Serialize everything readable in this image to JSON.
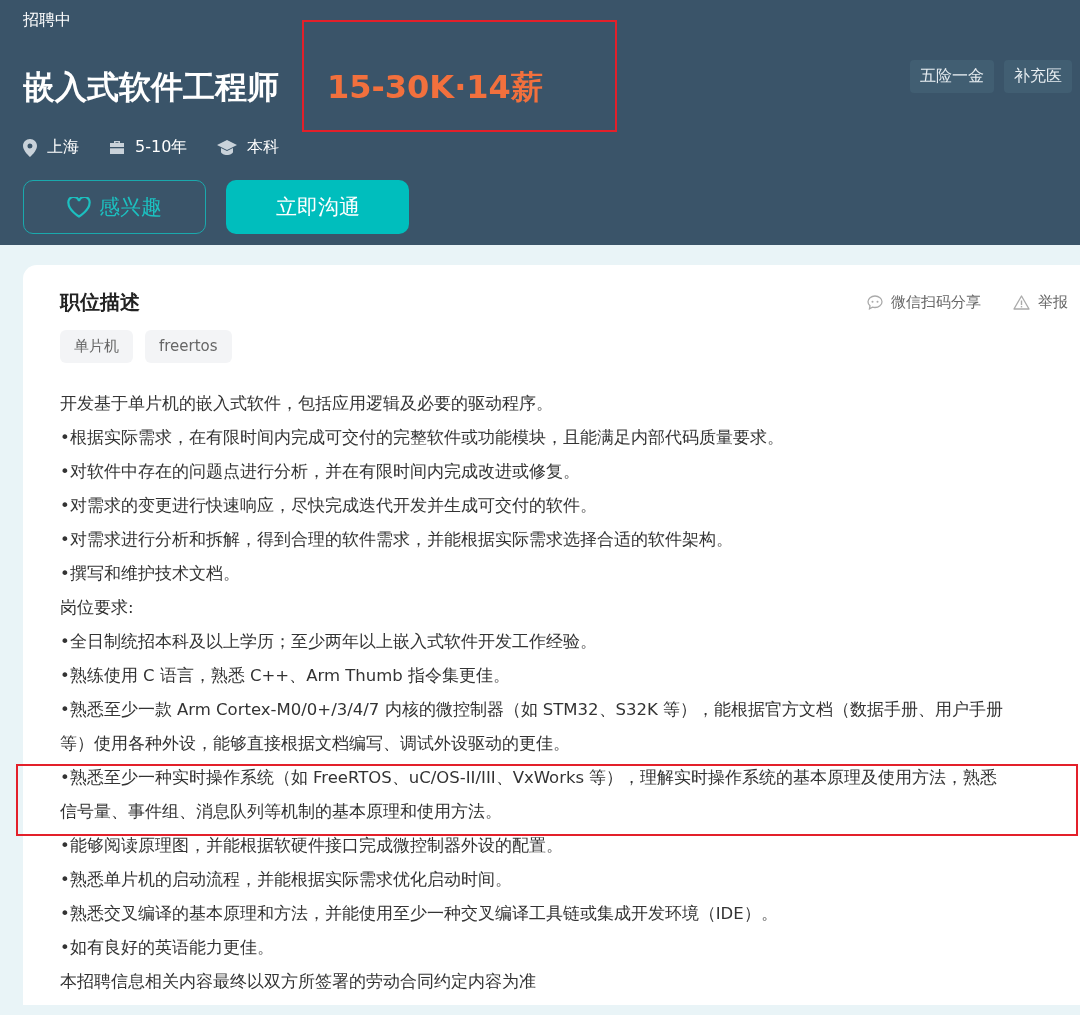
{
  "header": {
    "status": "招聘中",
    "title": "嵌入式软件工程师",
    "salary": {
      "text": "15-30K·14薪",
      "highlighted": true
    },
    "meta": [
      {
        "kind": "location",
        "text": "上海"
      },
      {
        "kind": "experience",
        "text": "5-10年"
      },
      {
        "kind": "education",
        "text": "本科"
      }
    ],
    "benefits": [
      "五险一金",
      "补充医"
    ],
    "buttons": [
      {
        "kind": "interest",
        "label": "感兴趣"
      },
      {
        "kind": "chat",
        "label": "立即沟通"
      }
    ]
  },
  "description": {
    "title": "职位描述",
    "actions": [
      {
        "kind": "share",
        "label": "微信扫码分享"
      },
      {
        "kind": "report",
        "label": "举报"
      }
    ],
    "tags": [
      "单片机",
      "freertos"
    ],
    "lines": [
      {
        "text": "开发基于单片机的嵌入式软件，包括应用逻辑及必要的驱动程序。",
        "highlighted": false
      },
      {
        "text": "•根据实际需求，在有限时间内完成可交付的完整软件或功能模块，且能满足内部代码质量要求。",
        "highlighted": false
      },
      {
        "text": "•对软件中存在的问题点进行分析，并在有限时间内完成改进或修复。",
        "highlighted": false
      },
      {
        "text": "•对需求的变更进行快速响应，尽快完成迭代开发并生成可交付的软件。",
        "highlighted": false
      },
      {
        "text": "•对需求进行分析和拆解，得到合理的软件需求，并能根据实际需求选择合适的软件架构。",
        "highlighted": false
      },
      {
        "text": "•撰写和维护技术文档。",
        "highlighted": false
      },
      {
        "text": "岗位要求:",
        "highlighted": false
      },
      {
        "text": "•全日制统招本科及以上学历；至少两年以上嵌入式软件开发工作经验。",
        "highlighted": false
      },
      {
        "text": "•熟练使用 C 语言，熟悉 C++、Arm Thumb 指令集更佳。",
        "highlighted": false
      },
      {
        "text": "•熟悉至少一款 Arm Cortex-M0/0+/3/4/7 内核的微控制器（如 STM32、S32K 等），能根据官方文档（数据手册、用户手册等）使用各种外设，能够直接根据文档编写、调试外设驱动的更佳。",
        "highlighted": false
      },
      {
        "text": "•熟悉至少一种实时操作系统（如 FreeRTOS、uC/OS-II/III、VxWorks 等），理解实时操作系统的基本原理及使用方法，熟悉信号量、事件组、消息队列等机制的基本原理和使用方法。",
        "highlighted": true
      },
      {
        "text": "•能够阅读原理图，并能根据软硬件接口完成微控制器外设的配置。",
        "highlighted": false
      },
      {
        "text": "•熟悉单片机的启动流程，并能根据实际需求优化启动时间。",
        "highlighted": false
      },
      {
        "text": "•熟悉交叉编译的基本原理和方法，并能使用至少一种交叉编译工具链或集成开发环境（IDE）。",
        "highlighted": false
      },
      {
        "text": "•如有良好的英语能力更佳。",
        "highlighted": false
      },
      {
        "text": "本招聘信息相关内容最终以双方所签署的劳动合同约定内容为准",
        "highlighted": false
      }
    ]
  }
}
